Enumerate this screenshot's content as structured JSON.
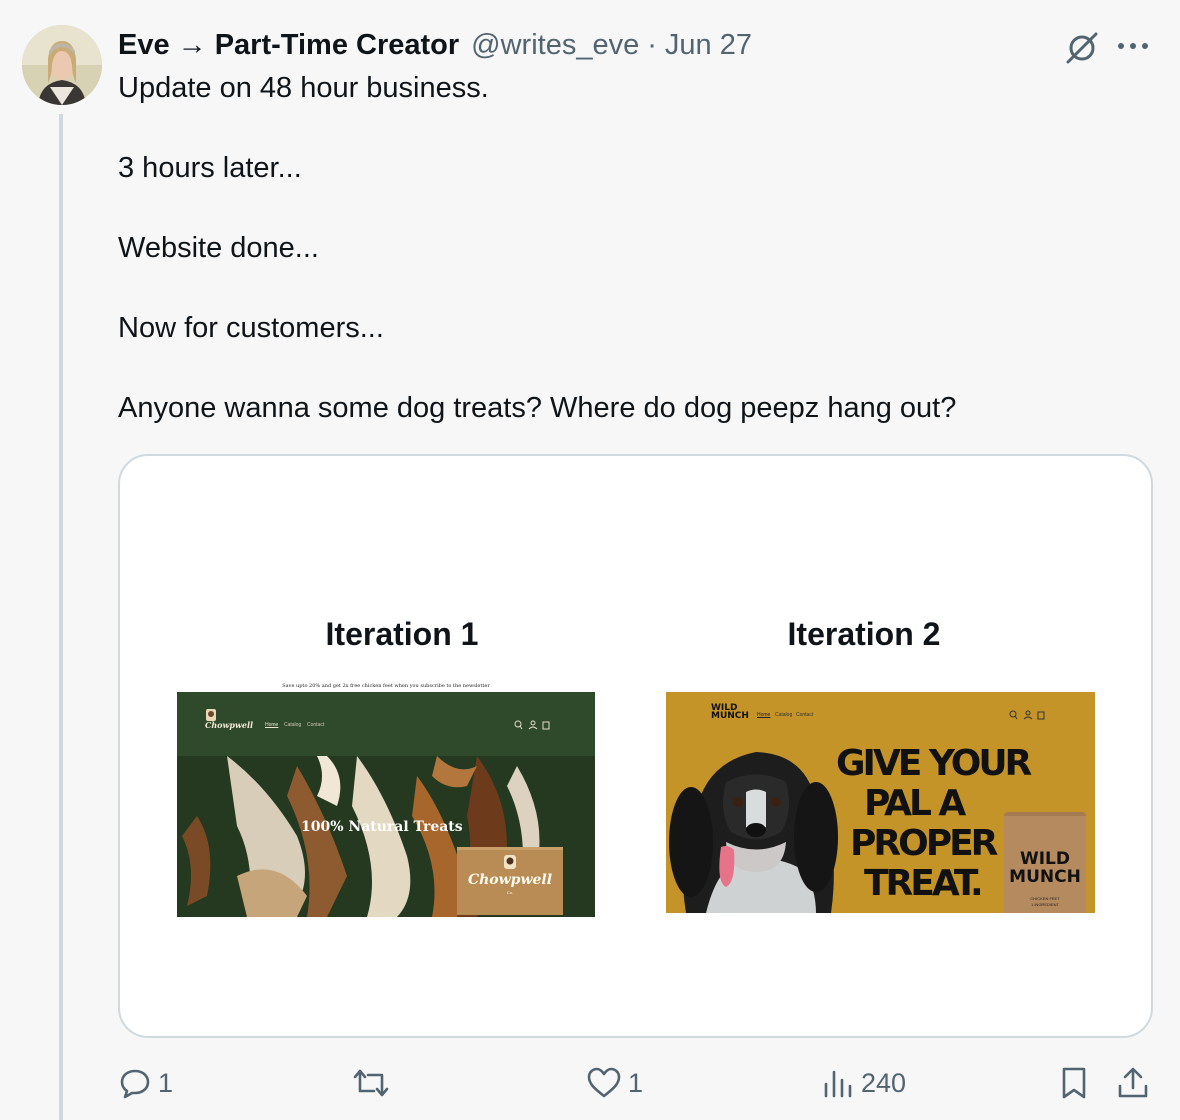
{
  "author": {
    "display_name": "Eve → Part-Time Creator",
    "handle": "@writes_eve",
    "separator": "·",
    "date": "Jun 27"
  },
  "tweet": {
    "lines": [
      "Update on 48 hour business.",
      "3 hours later...",
      "Website done...",
      "Now for customers...",
      "Anyone wanna some dog treats? Where do dog peepz hang out?"
    ]
  },
  "media": {
    "iteration1": {
      "title": "Iteration 1",
      "announcement": "Save upto 20% and get 2x free chicken feet when you subscribe to the newsletter",
      "logo": "Chowpwell",
      "nav": [
        "Home",
        "Catalog",
        "Contact"
      ],
      "hero_text": "100% Natural Treats",
      "box_logo": "Chowpwell",
      "box_sub": "Co.",
      "colors": {
        "header": "#2f4a2b",
        "hero": "#22381f",
        "box": "#b98c55"
      }
    },
    "iteration2": {
      "title": "Iteration 2",
      "logo": "WILD MUNCH",
      "nav": [
        "Home",
        "Catalog",
        "Contact"
      ],
      "hero_lines": [
        "GIVE YOUR",
        "PAL A",
        "PROPER",
        "TREAT."
      ],
      "pack_label": "WILD MUNCH",
      "pack_sub": "CHICKEN FEET",
      "pack_sub2": "1 INGREDIENT",
      "colors": {
        "background": "#c49428"
      }
    }
  },
  "actions": {
    "reply_count": "1",
    "retweet_count": "",
    "like_count": "1",
    "views_count": "240"
  },
  "icons": [
    "grok-icon",
    "more-icon",
    "reply-icon",
    "retweet-icon",
    "like-icon",
    "views-icon",
    "bookmark-icon",
    "share-icon"
  ],
  "colors": {
    "background": "#f7f7f7",
    "secondary_text": "#536471",
    "border": "#cfd9de",
    "text": "#0f1419"
  }
}
